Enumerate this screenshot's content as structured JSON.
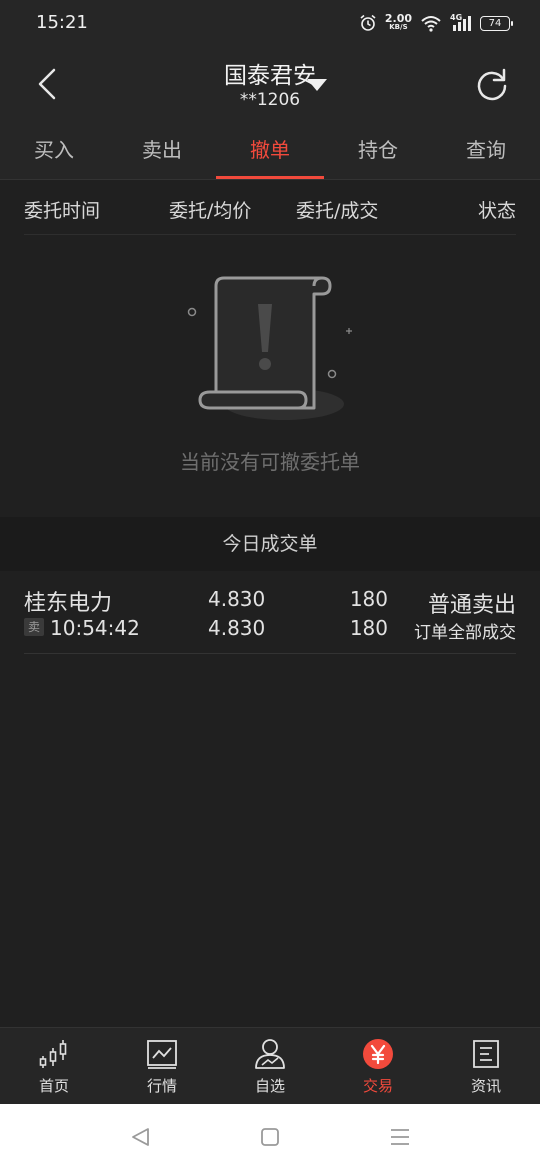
{
  "status_bar": {
    "time": "15:21",
    "net_speed_value": "2.00",
    "net_speed_unit": "KB/S",
    "network": "4G",
    "battery": "74",
    "icons": [
      "alarm-icon",
      "wifi-icon",
      "signal-icon",
      "battery-icon"
    ]
  },
  "header": {
    "broker_name": "国泰君安",
    "account": "**1206",
    "icons": [
      "back-arrow-icon",
      "dropdown-triangle-icon",
      "refresh-icon"
    ]
  },
  "tabs": [
    {
      "label": "买入",
      "active": false
    },
    {
      "label": "卖出",
      "active": false
    },
    {
      "label": "撤单",
      "active": true
    },
    {
      "label": "持仓",
      "active": false
    },
    {
      "label": "查询",
      "active": false
    }
  ],
  "columns": [
    "委托时间",
    "委托/均价",
    "委托/成交",
    "状态"
  ],
  "empty_state": {
    "message": "当前没有可撤委托单",
    "icon": "empty-scroll-icon"
  },
  "today_trades": {
    "title": "今日成交单",
    "rows": [
      {
        "stock_name": "桂东电力",
        "side_badge": "卖",
        "time": "10:54:42",
        "order_price": "4.830",
        "avg_price": "4.830",
        "order_qty": "180",
        "filled_qty": "180",
        "trade_type": "普通卖出",
        "status": "订单全部成交"
      }
    ]
  },
  "bottom_nav": [
    {
      "label": "首页",
      "icon": "candlestick-icon",
      "active": false
    },
    {
      "label": "行情",
      "icon": "chart-line-icon",
      "active": false
    },
    {
      "label": "自选",
      "icon": "user-chart-icon",
      "active": false
    },
    {
      "label": "交易",
      "icon": "yen-icon",
      "active": true
    },
    {
      "label": "资讯",
      "icon": "document-icon",
      "active": false
    }
  ],
  "colors": {
    "accent": "#f24a3c",
    "background": "#202020",
    "header_bg": "#262626",
    "muted_text": "#6f6f6f"
  }
}
